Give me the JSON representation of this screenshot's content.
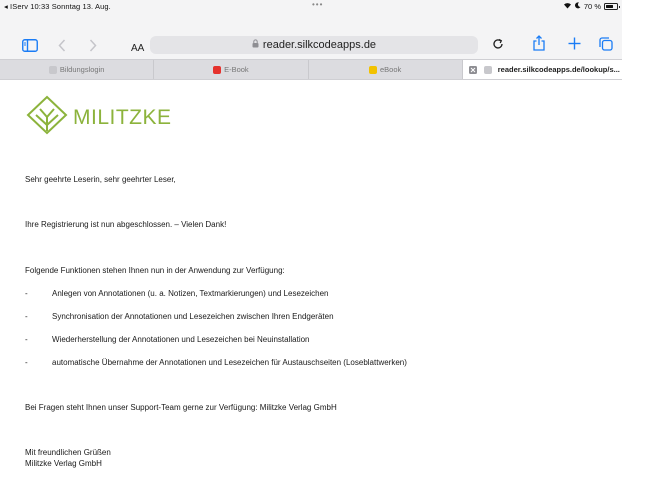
{
  "status_bar": {
    "left_text": "◂ IServ  10:33  Sonntag 13. Aug.",
    "dots": "•••",
    "battery_percent": "70 %",
    "battery_level": 0.7
  },
  "toolbar": {
    "text_size_label": "AA",
    "address": "reader.silkcodeapps.de"
  },
  "tabs": [
    {
      "label": "Bildungslogin",
      "favicon_color": "#c8c8cc"
    },
    {
      "label": "E-Book",
      "favicon_color": "#e5322d"
    },
    {
      "label": "eBook",
      "favicon_color": "#f2c200"
    },
    {
      "label": "reader.silkcodeapps.de/lookup/s...",
      "favicon_color": "#c8c8cc"
    }
  ],
  "page": {
    "logo_text": "MILITZKE",
    "greeting": "Sehr geehrte Leserin, sehr geehrter Leser,",
    "registration": "Ihre Registrierung ist nun abgeschlossen. – Vielen Dank!",
    "features_intro": "Folgende Funktionen stehen Ihnen nun in der Anwendung zur Verfügung:",
    "bullet_marker": "-",
    "features": [
      "Anlegen von Annotationen (u. a. Notizen, Textmarkierungen) und Lesezeichen",
      "Synchronisation der Annotationen und Lesezeichen zwischen Ihren Endgeräten",
      "Wiederherstellung der Annotationen und Lesezeichen bei Neuinstallation",
      "automatische Übernahme der Annotationen und Lesezeichen für Austauschseiten (Loseblattwerken)"
    ],
    "support": "Bei Fragen steht Ihnen unser Support-Team gerne zur Verfügung: Militzke Verlag GmbH",
    "closing": "Mit freundlichen Grüßen",
    "signature": "Militzke Verlag GmbH"
  },
  "colors": {
    "accent_blue": "#1a7cf5",
    "logo_green": "#8cb33c"
  }
}
